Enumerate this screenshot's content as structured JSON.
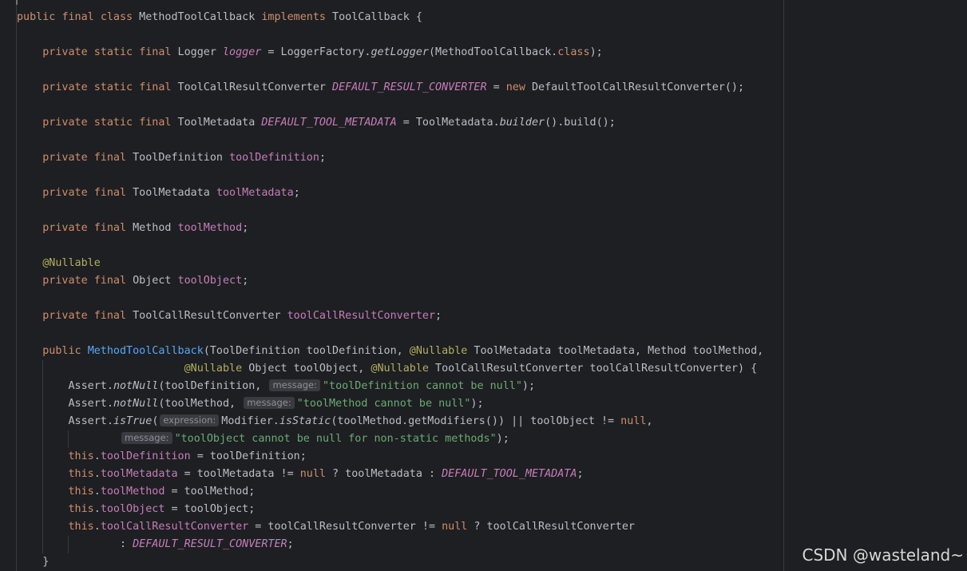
{
  "code": {
    "lines": [
      {
        "tokens": [
          {
            "t": "public",
            "c": "kw"
          },
          {
            "t": " "
          },
          {
            "t": "final",
            "c": "kw"
          },
          {
            "t": " "
          },
          {
            "t": "class",
            "c": "kw"
          },
          {
            "t": " MethodToolCallback "
          },
          {
            "t": "implements",
            "c": "kw"
          },
          {
            "t": " ToolCallback {"
          }
        ]
      },
      {
        "tokens": []
      },
      {
        "tokens": [
          {
            "t": "    "
          },
          {
            "t": "private",
            "c": "kw"
          },
          {
            "t": " "
          },
          {
            "t": "static",
            "c": "kw"
          },
          {
            "t": " "
          },
          {
            "t": "final",
            "c": "kw"
          },
          {
            "t": " Logger "
          },
          {
            "t": "logger",
            "c": "sfld"
          },
          {
            "t": " = LoggerFactory."
          },
          {
            "t": "getLogger",
            "c": "smth"
          },
          {
            "t": "(MethodToolCallback."
          },
          {
            "t": "class",
            "c": "kw"
          },
          {
            "t": ");"
          }
        ]
      },
      {
        "tokens": []
      },
      {
        "tokens": [
          {
            "t": "    "
          },
          {
            "t": "private",
            "c": "kw"
          },
          {
            "t": " "
          },
          {
            "t": "static",
            "c": "kw"
          },
          {
            "t": " "
          },
          {
            "t": "final",
            "c": "kw"
          },
          {
            "t": " ToolCallResultConverter "
          },
          {
            "t": "DEFAULT_RESULT_CONVERTER",
            "c": "sfld"
          },
          {
            "t": " = "
          },
          {
            "t": "new",
            "c": "kw"
          },
          {
            "t": " DefaultToolCallResultConverter();"
          }
        ]
      },
      {
        "tokens": []
      },
      {
        "tokens": [
          {
            "t": "    "
          },
          {
            "t": "private",
            "c": "kw"
          },
          {
            "t": " "
          },
          {
            "t": "static",
            "c": "kw"
          },
          {
            "t": " "
          },
          {
            "t": "final",
            "c": "kw"
          },
          {
            "t": " ToolMetadata "
          },
          {
            "t": "DEFAULT_TOOL_METADATA",
            "c": "sfld"
          },
          {
            "t": " = ToolMetadata."
          },
          {
            "t": "builder",
            "c": "smth"
          },
          {
            "t": "().build();"
          }
        ]
      },
      {
        "tokens": []
      },
      {
        "tokens": [
          {
            "t": "    "
          },
          {
            "t": "private",
            "c": "kw"
          },
          {
            "t": " "
          },
          {
            "t": "final",
            "c": "kw"
          },
          {
            "t": " ToolDefinition "
          },
          {
            "t": "toolDefinition",
            "c": "fld"
          },
          {
            "t": ";"
          }
        ]
      },
      {
        "tokens": []
      },
      {
        "tokens": [
          {
            "t": "    "
          },
          {
            "t": "private",
            "c": "kw"
          },
          {
            "t": " "
          },
          {
            "t": "final",
            "c": "kw"
          },
          {
            "t": " ToolMetadata "
          },
          {
            "t": "toolMetadata",
            "c": "fld"
          },
          {
            "t": ";"
          }
        ]
      },
      {
        "tokens": []
      },
      {
        "tokens": [
          {
            "t": "    "
          },
          {
            "t": "private",
            "c": "kw"
          },
          {
            "t": " "
          },
          {
            "t": "final",
            "c": "kw"
          },
          {
            "t": " Method "
          },
          {
            "t": "toolMethod",
            "c": "fld"
          },
          {
            "t": ";"
          }
        ]
      },
      {
        "tokens": []
      },
      {
        "tokens": [
          {
            "t": "    "
          },
          {
            "t": "@Nullable",
            "c": "ann"
          }
        ]
      },
      {
        "tokens": [
          {
            "t": "    "
          },
          {
            "t": "private",
            "c": "kw"
          },
          {
            "t": " "
          },
          {
            "t": "final",
            "c": "kw"
          },
          {
            "t": " Object "
          },
          {
            "t": "toolObject",
            "c": "fld"
          },
          {
            "t": ";"
          }
        ]
      },
      {
        "tokens": []
      },
      {
        "tokens": [
          {
            "t": "    "
          },
          {
            "t": "private",
            "c": "kw"
          },
          {
            "t": " "
          },
          {
            "t": "final",
            "c": "kw"
          },
          {
            "t": " ToolCallResultConverter "
          },
          {
            "t": "toolCallResultConverter",
            "c": "fld"
          },
          {
            "t": ";"
          }
        ]
      },
      {
        "tokens": []
      },
      {
        "tokens": [
          {
            "t": "    "
          },
          {
            "t": "public",
            "c": "kw"
          },
          {
            "t": " "
          },
          {
            "t": "MethodToolCallback",
            "c": "decl"
          },
          {
            "t": "(ToolDefinition toolDefinition, "
          },
          {
            "t": "@Nullable",
            "c": "ann"
          },
          {
            "t": " ToolMetadata toolMetadata, Method toolMethod,"
          }
        ]
      },
      {
        "tokens": [
          {
            "t": "                          "
          },
          {
            "t": "@Nullable",
            "c": "ann"
          },
          {
            "t": " Object toolObject, "
          },
          {
            "t": "@Nullable",
            "c": "ann"
          },
          {
            "t": " ToolCallResultConverter toolCallResultConverter) {"
          }
        ]
      },
      {
        "tokens": [
          {
            "t": "        Assert."
          },
          {
            "t": "notNull",
            "c": "smth"
          },
          {
            "t": "(toolDefinition, "
          },
          {
            "t": "message:",
            "c": "hint"
          },
          {
            "t": "\"toolDefinition cannot be null\"",
            "c": "str"
          },
          {
            "t": ");"
          }
        ]
      },
      {
        "tokens": [
          {
            "t": "        Assert."
          },
          {
            "t": "notNull",
            "c": "smth"
          },
          {
            "t": "(toolMethod, "
          },
          {
            "t": "message:",
            "c": "hint"
          },
          {
            "t": "\"toolMethod cannot be null\"",
            "c": "str"
          },
          {
            "t": ");"
          }
        ]
      },
      {
        "tokens": [
          {
            "t": "        Assert."
          },
          {
            "t": "isTrue",
            "c": "smth"
          },
          {
            "t": "("
          },
          {
            "t": "expression:",
            "c": "hint"
          },
          {
            "t": "Modifier."
          },
          {
            "t": "isStatic",
            "c": "smth"
          },
          {
            "t": "(toolMethod.getModifiers()) || toolObject != "
          },
          {
            "t": "null",
            "c": "kw"
          },
          {
            "t": ","
          }
        ]
      },
      {
        "tokens": [
          {
            "t": "                "
          },
          {
            "t": "message:",
            "c": "hint"
          },
          {
            "t": "\"toolObject cannot be null for non-static methods\"",
            "c": "str"
          },
          {
            "t": ");"
          }
        ]
      },
      {
        "tokens": [
          {
            "t": "        "
          },
          {
            "t": "this",
            "c": "kw"
          },
          {
            "t": "."
          },
          {
            "t": "toolDefinition",
            "c": "fld"
          },
          {
            "t": " = toolDefinition;"
          }
        ]
      },
      {
        "tokens": [
          {
            "t": "        "
          },
          {
            "t": "this",
            "c": "kw"
          },
          {
            "t": "."
          },
          {
            "t": "toolMetadata",
            "c": "fld"
          },
          {
            "t": " = toolMetadata != "
          },
          {
            "t": "null",
            "c": "kw"
          },
          {
            "t": " ? toolMetadata : "
          },
          {
            "t": "DEFAULT_TOOL_METADATA",
            "c": "sfld"
          },
          {
            "t": ";"
          }
        ]
      },
      {
        "tokens": [
          {
            "t": "        "
          },
          {
            "t": "this",
            "c": "kw"
          },
          {
            "t": "."
          },
          {
            "t": "toolMethod",
            "c": "fld"
          },
          {
            "t": " = toolMethod;"
          }
        ]
      },
      {
        "tokens": [
          {
            "t": "        "
          },
          {
            "t": "this",
            "c": "kw"
          },
          {
            "t": "."
          },
          {
            "t": "toolObject",
            "c": "fld"
          },
          {
            "t": " = toolObject;"
          }
        ]
      },
      {
        "tokens": [
          {
            "t": "        "
          },
          {
            "t": "this",
            "c": "kw"
          },
          {
            "t": "."
          },
          {
            "t": "toolCallResultConverter",
            "c": "fld"
          },
          {
            "t": " = toolCallResultConverter != "
          },
          {
            "t": "null",
            "c": "kw"
          },
          {
            "t": " ? toolCallResultConverter"
          }
        ]
      },
      {
        "tokens": [
          {
            "t": "                : "
          },
          {
            "t": "DEFAULT_RESULT_CONVERTER",
            "c": "sfld"
          },
          {
            "t": ";"
          }
        ]
      },
      {
        "tokens": [
          {
            "t": "    }"
          }
        ]
      }
    ]
  },
  "watermark": "CSDN @wasteland~",
  "colors": {
    "background": "#1e1f22",
    "text": "#bcbec4",
    "keyword": "#cf8e6d",
    "field": "#c77dbb",
    "string": "#6aab73",
    "annotation": "#b3ae60",
    "declaration": "#56a8f5",
    "inlay_hint_bg": "#393b40",
    "inlay_hint_text": "#8c8f94"
  }
}
